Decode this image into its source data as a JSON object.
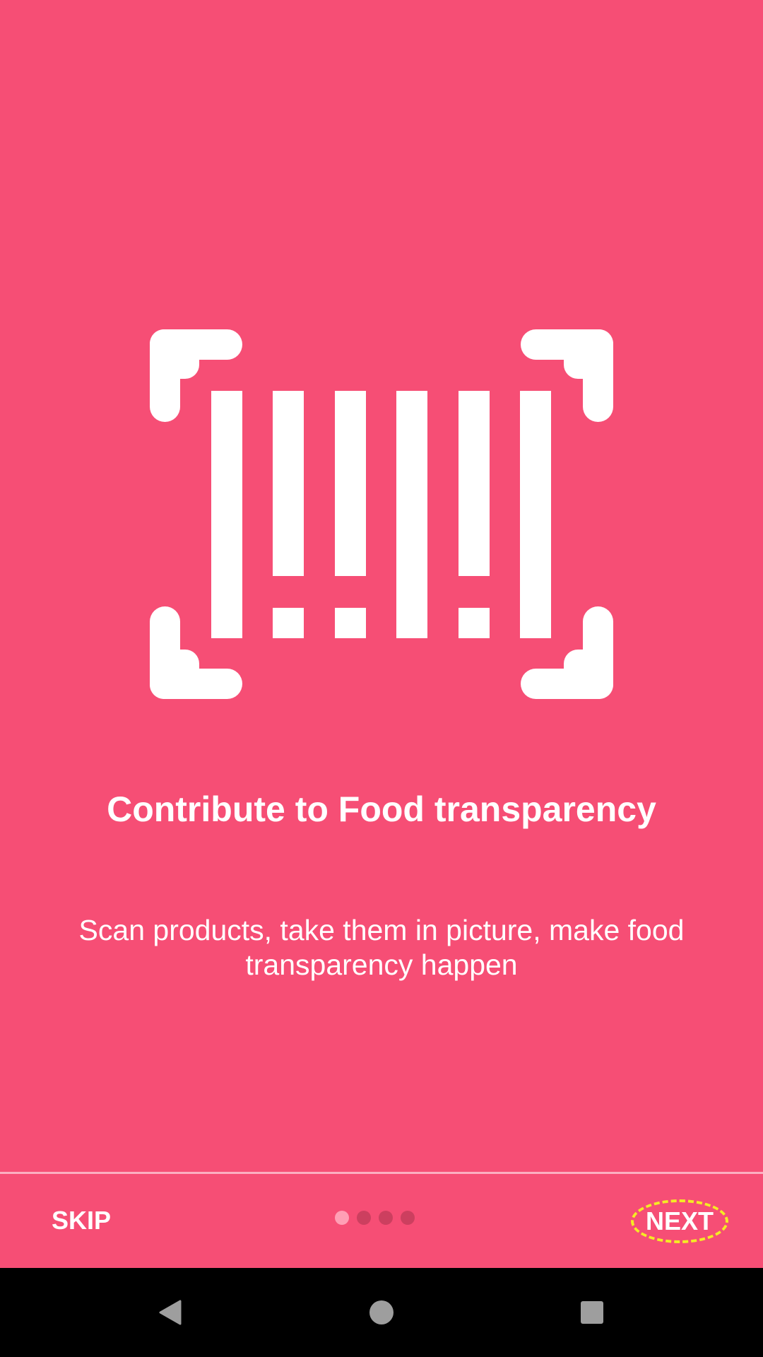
{
  "colors": {
    "background": "#f64e75",
    "text": "#ffffff",
    "dot_active": "#ff9fb5",
    "dot_inactive": "#cc3f5f",
    "highlight": "#f5eb24",
    "nav_bar": "#000000",
    "nav_icons": "#9e9e9e"
  },
  "illustration": {
    "icon": "barcode-scan-icon"
  },
  "onboarding": {
    "title": "Contribute to Food transparency",
    "description": "Scan products, take them in picture, make food transparency happen"
  },
  "controls": {
    "skip_label": "SKIP",
    "next_label": "NEXT",
    "page_indicator": {
      "total": 4,
      "current": 1
    }
  },
  "navigation": {
    "back_icon": "back-triangle-icon",
    "home_icon": "home-circle-icon",
    "recents_icon": "recents-square-icon"
  }
}
